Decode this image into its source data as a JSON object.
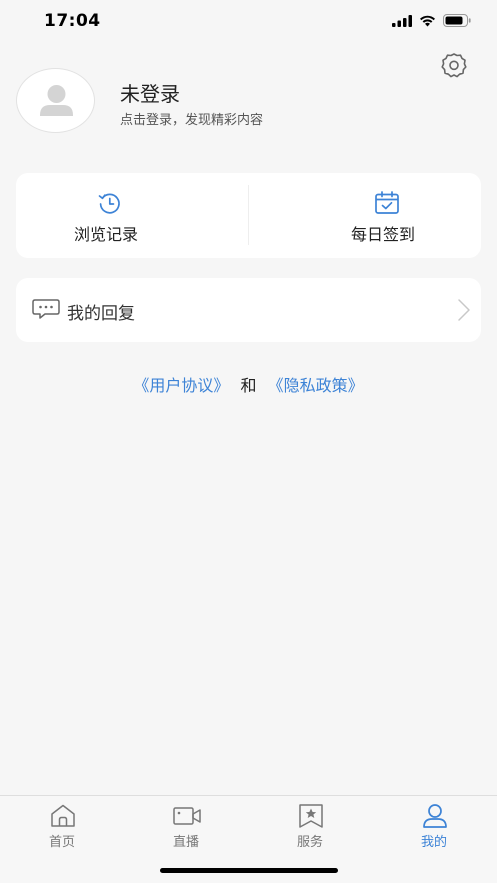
{
  "status_bar": {
    "time": "17:04"
  },
  "profile": {
    "name": "未登录",
    "subtitle": "点击登录，发现精彩内容"
  },
  "quick_actions": [
    {
      "label": "浏览记录",
      "icon": "history-icon"
    },
    {
      "label": "每日签到",
      "icon": "calendar-check-icon"
    }
  ],
  "reply": {
    "label": "我的回复",
    "icon": "chat-bubble-icon"
  },
  "agreement": {
    "user_agreement": "《用户协议》",
    "conjunction": "和",
    "privacy_policy": "《隐私政策》"
  },
  "tabs": [
    {
      "label": "首页",
      "icon": "home-icon",
      "active": false
    },
    {
      "label": "直播",
      "icon": "video-camera-icon",
      "active": false
    },
    {
      "label": "服务",
      "icon": "star-bookmark-icon",
      "active": false
    },
    {
      "label": "我的",
      "icon": "user-icon",
      "active": true
    }
  ],
  "colors": {
    "accent": "#3d83d6",
    "background": "#f6f6f6",
    "card": "#ffffff"
  }
}
